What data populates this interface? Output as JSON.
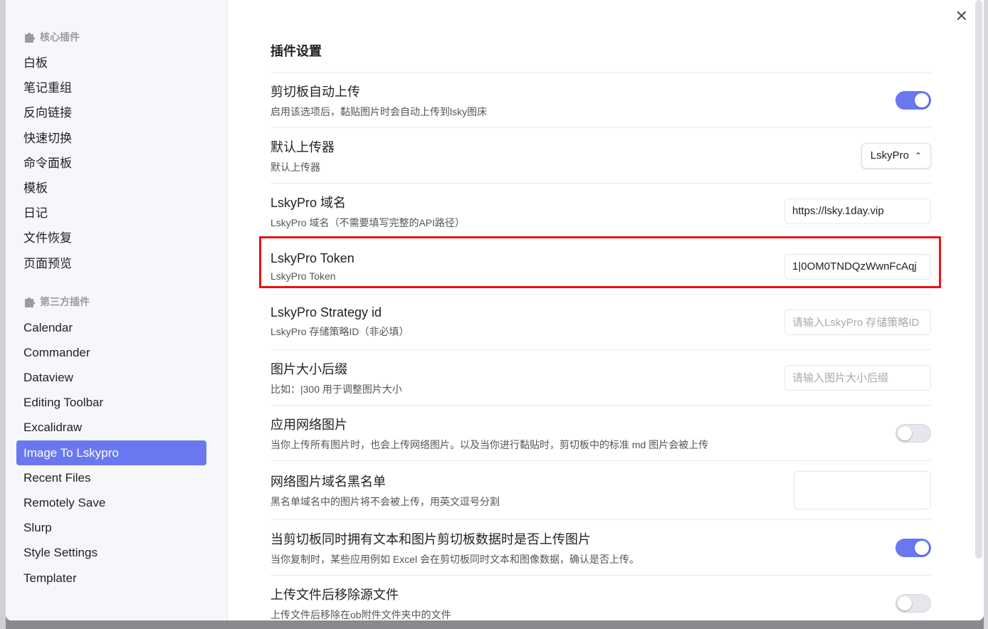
{
  "sidebar": {
    "core_title": "核心插件",
    "core_items": [
      "白板",
      "笔记重组",
      "反向链接",
      "快速切换",
      "命令面板",
      "模板",
      "日记",
      "文件恢复",
      "页面预览"
    ],
    "third_title": "第三方插件",
    "third_items": [
      "Calendar",
      "Commander",
      "Dataview",
      "Editing Toolbar",
      "Excalidraw",
      "Image To Lskypro",
      "Recent Files",
      "Remotely Save",
      "Slurp",
      "Style Settings",
      "Templater"
    ],
    "active": "Image To Lskypro"
  },
  "content": {
    "title": "插件设置",
    "settings": [
      {
        "name": "剪切板自动上传",
        "desc": "启用该选项后，黏贴图片时会自动上传到lsky图床",
        "toggle": true
      },
      {
        "name": "默认上传器",
        "desc": "默认上传器",
        "select": "LskyPro"
      },
      {
        "name": "LskyPro 域名",
        "desc": "LskyPro 域名（不需要填写完整的API路径）",
        "value": "https://lsky.1day.vip"
      },
      {
        "name": "LskyPro Token",
        "desc": "LskyPro Token",
        "value": "1|0OM0TNDQzWwnFcAqj"
      },
      {
        "name": "LskyPro Strategy id",
        "desc": "LskyPro 存储策略ID（非必填）",
        "placeholder": "请输入LskyPro 存储策略ID"
      },
      {
        "name": "图片大小后缀",
        "desc": "比如：|300 用于调整图片大小",
        "placeholder": "请输入图片大小后缀"
      },
      {
        "name": "应用网络图片",
        "desc": "当你上传所有图片时，也会上传网络图片。以及当你进行黏贴时，剪切板中的标准 md 图片会被上传",
        "toggle": false
      },
      {
        "name": "网络图片域名黑名单",
        "desc": "黑名单域名中的图片将不会被上传，用英文逗号分割"
      },
      {
        "name": "当剪切板同时拥有文本和图片剪切板数据时是否上传图片",
        "desc": "当你复制时，某些应用例如 Excel 会在剪切板同时文本和图像数据，确认是否上传。",
        "toggle": true
      },
      {
        "name": "上传文件后移除源文件",
        "desc": "上传文件后移除在ob附件文件夹中的文件",
        "toggle": false
      }
    ]
  },
  "colors": {
    "accent": "#6a78f0",
    "highlight": "#f01010"
  }
}
